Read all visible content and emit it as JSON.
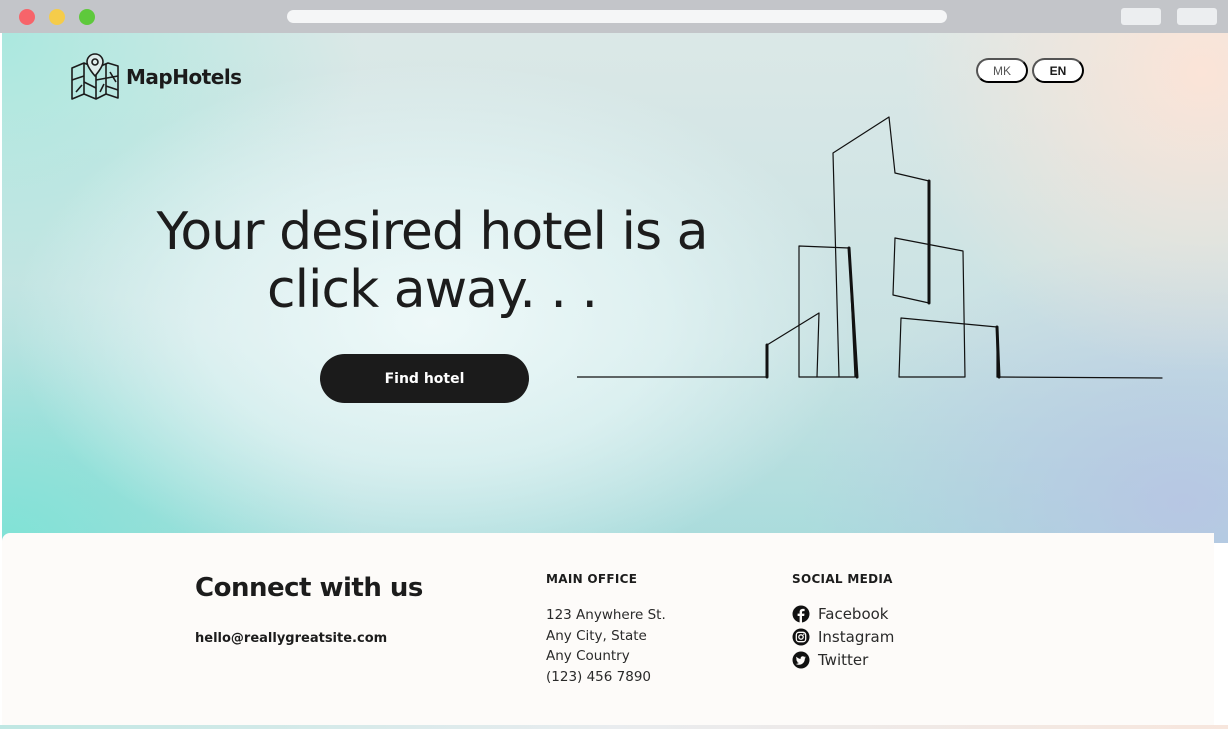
{
  "brand": {
    "name": "MapHotels"
  },
  "language": {
    "options": [
      "MK",
      "EN"
    ],
    "selected": "EN"
  },
  "hero": {
    "headline_line1": "Your desired hotel is a",
    "headline_line2": "click away. . .",
    "cta_label": "Find hotel"
  },
  "footer": {
    "connect_title": "Connect with us",
    "email": "hello@reallygreatsite.com",
    "office": {
      "heading": "MAIN OFFICE",
      "lines": [
        "123 Anywhere St.",
        "Any City, State",
        "Any Country",
        "(123) 456 7890"
      ]
    },
    "social": {
      "heading": "SOCIAL MEDIA",
      "items": [
        {
          "label": "Facebook",
          "icon": "facebook-icon"
        },
        {
          "label": "Instagram",
          "icon": "instagram-icon"
        },
        {
          "label": "Twitter",
          "icon": "twitter-icon"
        }
      ]
    }
  },
  "colors": {
    "dark": "#1b1b1b",
    "footer_bg": "#fdfbf9",
    "traffic_red": "#f7646a",
    "traffic_yellow": "#f5cc4a",
    "traffic_green": "#5ec93c"
  }
}
